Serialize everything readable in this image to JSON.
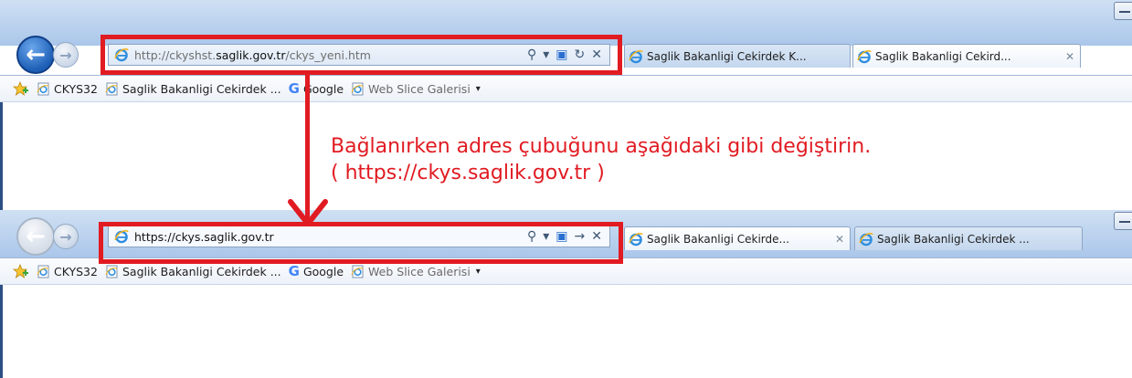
{
  "top_browser": {
    "address_url_prefix": "http://ckyshst.",
    "address_url_domain": "saglik.gov.tr",
    "address_url_path": "/ckys_yeni.htm",
    "tabs": [
      {
        "title": "Saglik Bakanligi Cekirdek K...",
        "active": false
      },
      {
        "title": "Saglik Bakanligi Cekird...",
        "active": true
      }
    ]
  },
  "bottom_browser": {
    "address_url": "https://ckys.saglik.gov.tr",
    "tabs": [
      {
        "title": "Saglik Bakanligi Cekirde...",
        "active": true
      },
      {
        "title": "Saglik Bakanligi Cekirdek ...",
        "active": false
      }
    ]
  },
  "address_buttons": {
    "search": "⚲",
    "dropdown": "▾",
    "refresh": "↻",
    "go": "→",
    "stop": "✕"
  },
  "tab_close": "✕",
  "favorites": {
    "items": [
      {
        "label": "CKYS32",
        "icon": "ie-page-icon"
      },
      {
        "label": "Saglik Bakanligi Cekirdek ...",
        "icon": "ie-page-icon"
      },
      {
        "label": "Google",
        "icon": "google-icon"
      },
      {
        "label": "Web Slice Galerisi",
        "icon": "ie-page-icon"
      }
    ],
    "google_glyph": "G",
    "caret": "▾"
  },
  "annotation": {
    "line1": "Bağlanırken adres çubuğunu aşağıdaki gibi değiştirin.",
    "line2": "( https://ckys.saglik.gov.tr )",
    "color": "#e11b22"
  },
  "nav": {
    "back_glyph": "←",
    "forward_glyph": "→"
  },
  "colors": {
    "chrome": "#b9d1ee",
    "highlight": "#e11b22"
  }
}
